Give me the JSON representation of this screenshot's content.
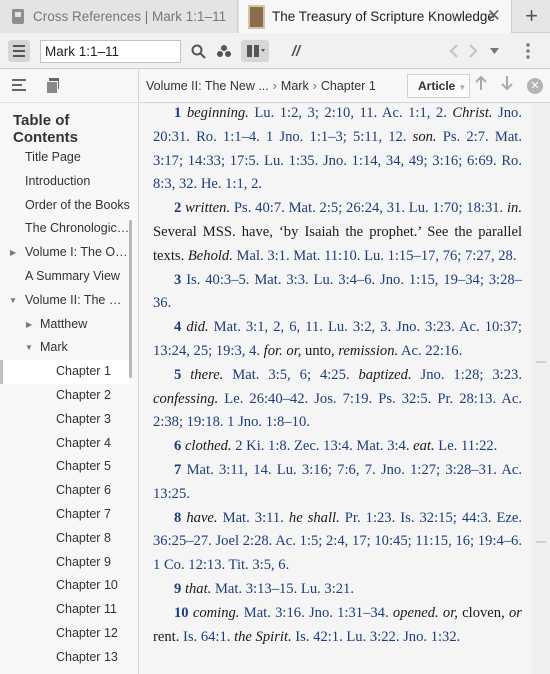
{
  "tabs": [
    {
      "title": "Cross References | Mark 1:1–11"
    },
    {
      "title": "The Treasury of Scripture Knowledge",
      "close": "✕"
    }
  ],
  "new_tab": "+",
  "toolbar": {
    "reference_value": "Mark 1:1–11",
    "parallel_label": "//"
  },
  "sidebar": {
    "title": "Table of Contents",
    "items": [
      {
        "label": "Title Page"
      },
      {
        "label": "Introduction"
      },
      {
        "label": "Order of the Books"
      },
      {
        "label": "The Chronological Order"
      },
      {
        "label": "Volume I: The Old Testament"
      },
      {
        "label": "A Summary View"
      },
      {
        "label": "Volume II: The New Testament"
      },
      {
        "label": "Matthew"
      },
      {
        "label": "Mark"
      },
      {
        "label": "Chapter 1"
      },
      {
        "label": "Chapter 2"
      },
      {
        "label": "Chapter 3"
      },
      {
        "label": "Chapter 4"
      },
      {
        "label": "Chapter 5"
      },
      {
        "label": "Chapter 6"
      },
      {
        "label": "Chapter 7"
      },
      {
        "label": "Chapter 8"
      },
      {
        "label": "Chapter 9"
      },
      {
        "label": "Chapter 10"
      },
      {
        "label": "Chapter 11"
      },
      {
        "label": "Chapter 12"
      },
      {
        "label": "Chapter 13"
      }
    ]
  },
  "breadcrumb": {
    "volume": "Volume II: The New ...",
    "book": "Mark",
    "chapter": "Chapter 1",
    "separator": "›"
  },
  "article_button": "Article",
  "verses": [
    {
      "n": "1",
      "parts": [
        [
          "kw",
          "beginning."
        ],
        [
          "ref",
          " Lu. 1:2, 3; 2:10, 11. Ac. 1:1, 2. "
        ],
        [
          "kw",
          "Christ."
        ],
        [
          "ref",
          " Jno. 20:31. Ro. 1:1–4. 1 Jno. 1:1–3; 5:11, 12. "
        ],
        [
          "kw",
          "son."
        ],
        [
          "ref",
          " Ps. 2:7. Mat. 3:17; 14:33; 17:5. Lu. 1:35. Jno. 1:14, 34, 49; 3:16; 6:69. Ro. 8:3, 32. He. 1:1, 2."
        ]
      ]
    },
    {
      "n": "2",
      "parts": [
        [
          "kw",
          "written."
        ],
        [
          "ref",
          " Ps. 40:7. Mat. 2:5; 26:24, 31. Lu. 1:70; 18:31. "
        ],
        [
          "kw",
          "in."
        ],
        [
          "txt",
          " Several MSS. have, ‘by Isaiah the prophet.’ See the parallel texts. "
        ],
        [
          "kw",
          "Behold."
        ],
        [
          "ref",
          " Mal. 3:1. Mat. 11:10. Lu. 1:15–17, 76; 7:27, 28."
        ]
      ]
    },
    {
      "n": "3",
      "parts": [
        [
          "ref",
          "Is. 40:3–5. Mat. 3:3. Lu. 3:4–6. Jno. 1:15, 19–34; 3:28–36."
        ]
      ]
    },
    {
      "n": "4",
      "parts": [
        [
          "kw",
          "did."
        ],
        [
          "ref",
          " Mat. 3:1, 2, 6, 11. Lu. 3:2, 3. Jno. 3:23. Ac. 10:37; 13:24, 25; 19:3, 4. "
        ],
        [
          "kw",
          "for."
        ],
        [
          "txt",
          " "
        ],
        [
          "kw",
          "or,"
        ],
        [
          "txt",
          " unto, "
        ],
        [
          "kw",
          "remission."
        ],
        [
          "ref",
          " Ac. 22:16."
        ]
      ]
    },
    {
      "n": "5",
      "parts": [
        [
          "kw",
          "there."
        ],
        [
          "ref",
          " Mat. 3:5, 6; 4:25. "
        ],
        [
          "kw",
          "baptized."
        ],
        [
          "ref",
          " Jno. 1:28; 3:23. "
        ],
        [
          "kw",
          "confessing."
        ],
        [
          "ref",
          " Le. 26:40–42. Jos. 7:19. Ps. 32:5. Pr. 28:13. Ac. 2:38; 19:18. 1 Jno. 1:8–10."
        ]
      ]
    },
    {
      "n": "6",
      "parts": [
        [
          "kw",
          "clothed."
        ],
        [
          "ref",
          " 2 Ki. 1:8. Zec. 13:4. Mat. 3:4. "
        ],
        [
          "kw",
          "eat."
        ],
        [
          "ref",
          " Le. 11:22."
        ]
      ]
    },
    {
      "n": "7",
      "parts": [
        [
          "ref",
          "Mat. 3:11, 14. Lu. 3:16; 7:6, 7. Jno. 1:27; 3:28–31. Ac. 13:25."
        ]
      ]
    },
    {
      "n": "8",
      "parts": [
        [
          "kw",
          "have."
        ],
        [
          "ref",
          " Mat. 3:11. "
        ],
        [
          "kw",
          "he shall."
        ],
        [
          "ref",
          " Pr. 1:23. Is. 32:15; 44:3. Eze. 36:25–27. Joel 2:28. Ac. 1:5; 2:4, 17; 10:45; 11:15, 16; 19:4–6. 1 Co. 12:13. Tit. 3:5, 6."
        ]
      ]
    },
    {
      "n": "9",
      "parts": [
        [
          "kw",
          "that."
        ],
        [
          "ref",
          " Mat. 3:13–15. Lu. 3:21."
        ]
      ]
    },
    {
      "n": "10",
      "parts": [
        [
          "kw",
          "coming."
        ],
        [
          "ref",
          " Mat. 3:16. Jno. 1:31–34. "
        ],
        [
          "kw",
          "opened."
        ],
        [
          "txt",
          " "
        ],
        [
          "kw",
          "or,"
        ],
        [
          "txt",
          " cloven, "
        ],
        [
          "kw",
          "or"
        ],
        [
          "txt",
          " rent. "
        ],
        [
          "ref",
          "Is. 64:1. "
        ],
        [
          "kw",
          "the Spirit."
        ],
        [
          "ref",
          " Is. 42:1. Lu. 3:22. Jno. 1:32."
        ]
      ]
    }
  ]
}
